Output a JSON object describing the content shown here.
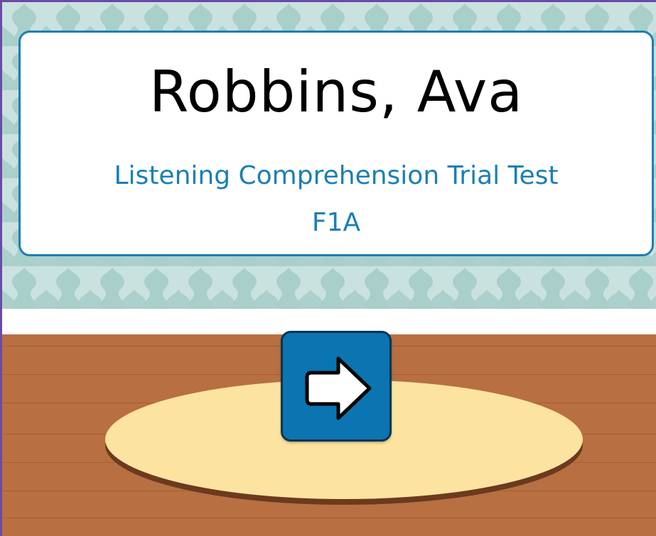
{
  "student": {
    "name": "Robbins, Ava"
  },
  "test": {
    "title": "Listening Comprehension Trial Test",
    "code": "F1A"
  },
  "navigation": {
    "next_icon": "arrow-right-icon"
  },
  "colors": {
    "wallpaper": "#c9e2e0",
    "wallpaper_pattern": "#a9cfcb",
    "card_border": "#1b7fb3",
    "title_text": "#1b7fb3",
    "floor": "#b86f42",
    "rug": "#fde3a0",
    "button": "#0a75b1"
  }
}
